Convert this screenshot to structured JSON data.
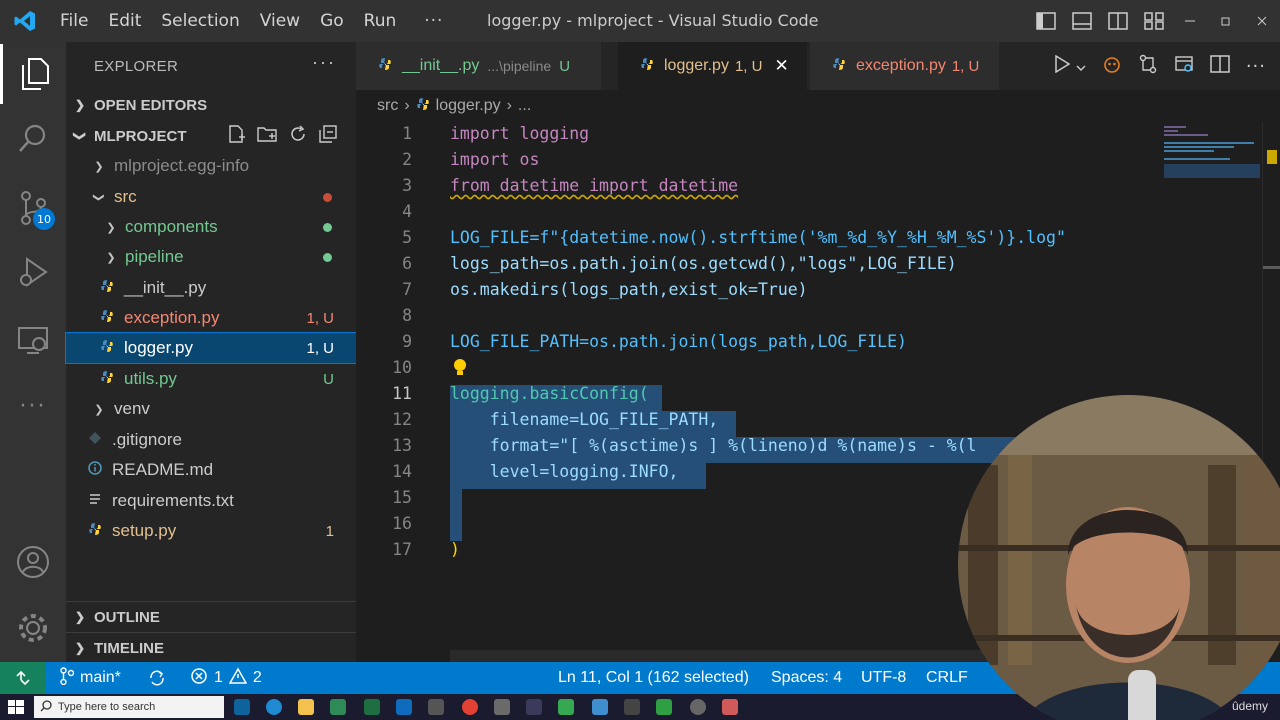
{
  "app": {
    "window_title": "logger.py - mlproject - Visual Studio Code"
  },
  "menu": [
    "File",
    "Edit",
    "Selection",
    "View",
    "Go",
    "Run",
    "···"
  ],
  "activity": {
    "scm_badge": "10"
  },
  "sidebar": {
    "title": "EXPLORER",
    "more": "···",
    "open_editors": "OPEN EDITORS",
    "project": "MLPROJECT",
    "outline": "OUTLINE",
    "timeline": "TIMELINE",
    "tree": [
      {
        "label": "mlproject.egg-info",
        "badge": ""
      },
      {
        "label": "src",
        "badge": ""
      },
      {
        "label": "components",
        "badge": ""
      },
      {
        "label": "pipeline",
        "badge": ""
      },
      {
        "label": "__init__.py",
        "badge": ""
      },
      {
        "label": "exception.py",
        "badge": "1, U"
      },
      {
        "label": "logger.py",
        "badge": "1, U"
      },
      {
        "label": "utils.py",
        "badge": "U"
      },
      {
        "label": "venv",
        "badge": ""
      },
      {
        "label": ".gitignore",
        "badge": ""
      },
      {
        "label": "README.md",
        "badge": ""
      },
      {
        "label": "requirements.txt",
        "badge": ""
      },
      {
        "label": "setup.py",
        "badge": "1"
      }
    ]
  },
  "tabs": [
    {
      "label": "__init__.py",
      "path": "...\\pipeline",
      "badge": "U"
    },
    {
      "label": "logger.py",
      "badge": "1, U",
      "close": "✕"
    },
    {
      "label": "exception.py",
      "badge": "1, U"
    }
  ],
  "breadcrumb": {
    "folder": "src",
    "sep": "›",
    "file": "logger.py",
    "more": "..."
  },
  "editor": {
    "line_numbers": [
      "1",
      "2",
      "3",
      "4",
      "5",
      "6",
      "7",
      "8",
      "9",
      "10",
      "11",
      "12",
      "13",
      "14",
      "15",
      "16",
      "17"
    ],
    "lines": [
      "import logging",
      "import os",
      "from datetime import datetime",
      "",
      "LOG_FILE=f\"{datetime.now().strftime('%m_%d_%Y_%H_%M_%S')}.log\"",
      "logs_path=os.path.join(os.getcwd(),\"logs\",LOG_FILE)",
      "os.makedirs(logs_path,exist_ok=True)",
      "",
      "LOG_FILE_PATH=os.path.join(logs_path,LOG_FILE)",
      "",
      "logging.basicConfig(",
      "    filename=LOG_FILE_PATH,",
      "    format=\"[ %(asctime)s ] %(lineno)d %(name)s - %(l",
      "    level=logging.INFO,",
      "",
      "",
      ")"
    ]
  },
  "status": {
    "branch": "main*",
    "errors": "1",
    "warnings": "2",
    "position": "Ln 11, Col 1 (162 selected)",
    "spaces": "Spaces: 4",
    "encoding": "UTF-8",
    "eol": "CRLF"
  },
  "taskbar": {
    "search_placeholder": "Type here to search",
    "watermark": "ûdemy"
  },
  "colors": {
    "accent": "#007acc",
    "selection": "#094771",
    "modified": "#73c991",
    "error": "#f48771"
  }
}
